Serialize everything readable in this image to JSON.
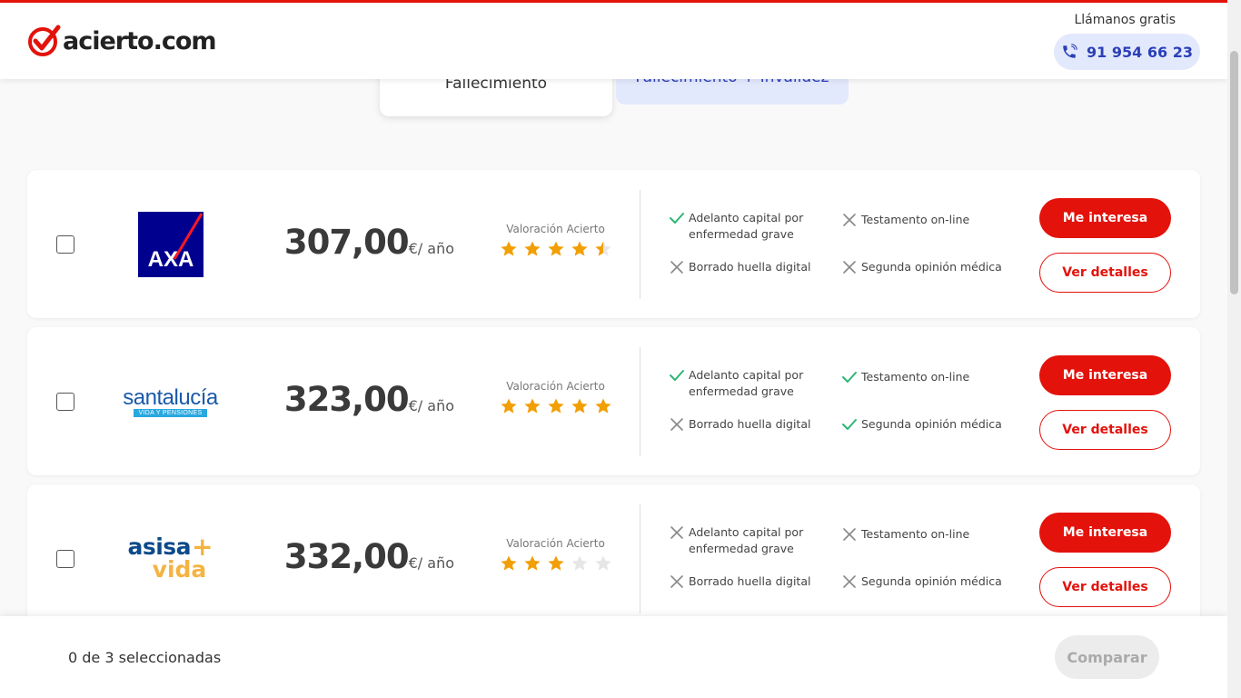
{
  "header": {
    "brand": "acierto.com",
    "call_label": "Llámanos gratis",
    "phone": "91 954 66 23"
  },
  "tabs": [
    {
      "label": "Fallecimiento",
      "active": true
    },
    {
      "label": "Fallecimiento + Invalidez",
      "active": false
    }
  ],
  "offers": [
    {
      "insurer": "AXA",
      "price": "307,00",
      "unit": "€/ año",
      "rating_label": "Valoración Acierto",
      "rating": 4.5,
      "features": {
        "f1": {
          "label": "Adelanto capital por enfermedad grave",
          "included": true
        },
        "f2": {
          "label": "Testamento on-line",
          "included": false
        },
        "f3": {
          "label": "Borrado huella digital",
          "included": false
        },
        "f4": {
          "label": "Segunda opinión médica",
          "included": false
        }
      },
      "primary": "Me interesa",
      "secondary": "Ver detalles"
    },
    {
      "insurer": "santalucía",
      "insurer_sub": "VIDA Y PENSIONES",
      "price": "323,00",
      "unit": "€/ año",
      "rating_label": "Valoración Acierto",
      "rating": 5,
      "features": {
        "f1": {
          "label": "Adelanto capital por enfermedad grave",
          "included": true
        },
        "f2": {
          "label": "Testamento on-line",
          "included": true
        },
        "f3": {
          "label": "Borrado huella digital",
          "included": false
        },
        "f4": {
          "label": "Segunda opinión médica",
          "included": true
        }
      },
      "primary": "Me interesa",
      "secondary": "Ver detalles"
    },
    {
      "insurer": "asisa",
      "insurer_sub": "vida",
      "price": "332,00",
      "unit": "€/ año",
      "rating_label": "Valoración Acierto",
      "rating": 3,
      "features": {
        "f1": {
          "label": "Adelanto capital por enfermedad grave",
          "included": false
        },
        "f2": {
          "label": "Testamento on-line",
          "included": false
        },
        "f3": {
          "label": "Borrado huella digital",
          "included": false
        },
        "f4": {
          "label": "Segunda opinión médica",
          "included": false
        }
      },
      "primary": "Me interesa",
      "secondary": "Ver detalles"
    }
  ],
  "footer": {
    "selected": "0 de 3 seleccionadas",
    "compare": "Comparar"
  },
  "colors": {
    "brand_red": "#e3120b",
    "accent_blue": "#2b3fb8",
    "light_blue": "#e3e9fc",
    "check_green": "#2bb673",
    "star_orange": "#f29f05"
  }
}
